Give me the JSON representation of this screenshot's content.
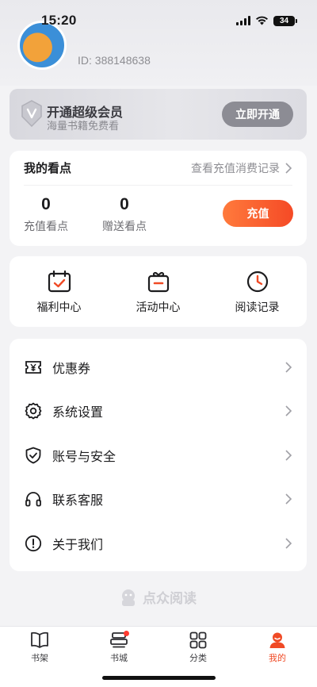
{
  "status": {
    "time": "15:20",
    "battery": "34"
  },
  "profile": {
    "user_id": "ID: 388148638"
  },
  "vip": {
    "title": "开通超级会员",
    "subtitle": "海量书籍免费看",
    "button": "立即开通"
  },
  "points": {
    "title": "我的看点",
    "link": "查看充值消费记录",
    "recharge_value": "0",
    "recharge_label": "充值看点",
    "gift_value": "0",
    "gift_label": "赠送看点",
    "recharge_button": "充值"
  },
  "shortcuts": [
    {
      "label": "福利中心",
      "icon": "calendar-check-icon"
    },
    {
      "label": "活动中心",
      "icon": "gift-icon"
    },
    {
      "label": "阅读记录",
      "icon": "clock-icon"
    }
  ],
  "menu": [
    {
      "label": "优惠券",
      "icon": "coupon-icon"
    },
    {
      "label": "系统设置",
      "icon": "gear-icon"
    },
    {
      "label": "账号与安全",
      "icon": "shield-icon"
    },
    {
      "label": "联系客服",
      "icon": "headset-icon"
    },
    {
      "label": "关于我们",
      "icon": "info-icon"
    }
  ],
  "brand": {
    "name": "点众阅读"
  },
  "tabs": [
    {
      "label": "书架",
      "icon": "book-icon",
      "active": false
    },
    {
      "label": "书城",
      "icon": "bookstore-icon",
      "active": false,
      "badge": true
    },
    {
      "label": "分类",
      "icon": "grid-icon",
      "active": false
    },
    {
      "label": "我的",
      "icon": "profile-icon",
      "active": true
    }
  ],
  "colors": {
    "accent": "#F04A25",
    "vip_button": "#8C8C94"
  }
}
